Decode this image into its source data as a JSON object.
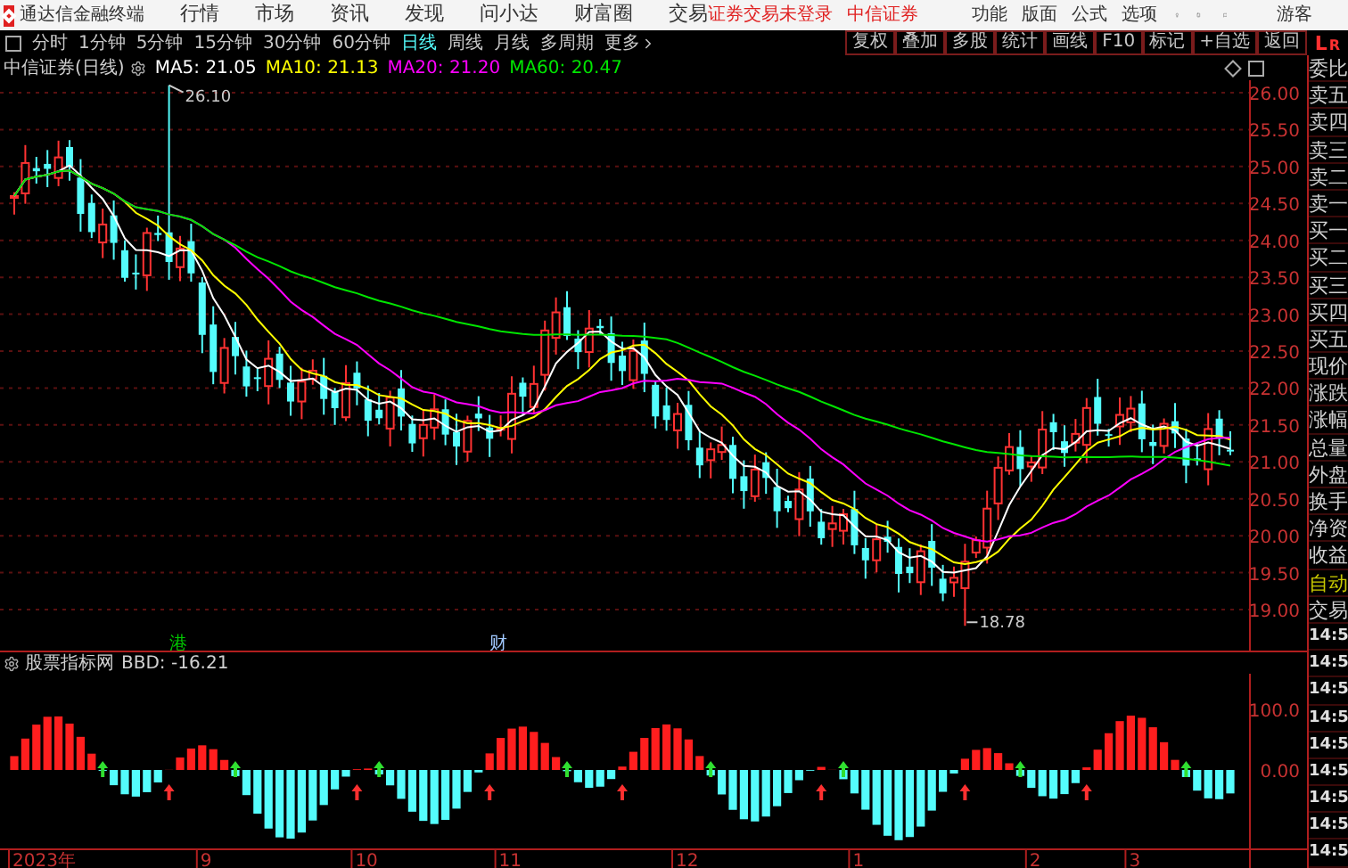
{
  "menu_bar": {
    "app_name": "通达信金融终端",
    "menus": [
      "行情",
      "市场",
      "资讯",
      "发现",
      "问小达",
      "财富圈",
      "交易"
    ],
    "login_status": "证券交易未登录",
    "broker": "中信证券",
    "actions": [
      "功能",
      "版面",
      "公式",
      "选项"
    ],
    "user": "游客"
  },
  "toolbar": {
    "periods": [
      {
        "label": "分时",
        "selected": false
      },
      {
        "label": "1分钟",
        "selected": false
      },
      {
        "label": "5分钟",
        "selected": false
      },
      {
        "label": "15分钟",
        "selected": false
      },
      {
        "label": "30分钟",
        "selected": false
      },
      {
        "label": "60分钟",
        "selected": false
      },
      {
        "label": "日线",
        "selected": true
      },
      {
        "label": "周线",
        "selected": false
      },
      {
        "label": "月线",
        "selected": false
      },
      {
        "label": "多周期",
        "selected": false
      },
      {
        "label": "更多",
        "selected": false
      }
    ],
    "buttons": [
      "复权",
      "叠加",
      "多股",
      "统计",
      "画线",
      "F10",
      "标记",
      "+自选",
      "返回"
    ],
    "panel_toggle": [
      "L",
      "R"
    ]
  },
  "legend": {
    "title": "中信证券(日线)",
    "averages": [
      {
        "label": "MA5: 21.05",
        "color": "#ffffff"
      },
      {
        "label": "MA10: 21.13",
        "color": "#ffff00"
      },
      {
        "label": "MA20: 21.20",
        "color": "#ff00ff"
      },
      {
        "label": "MA60: 20.47",
        "color": "#00e600"
      }
    ]
  },
  "price_axis": [
    "26.00",
    "25.50",
    "25.00",
    "24.50",
    "24.00",
    "23.50",
    "23.00",
    "22.50",
    "22.00",
    "21.50",
    "21.00",
    "20.50",
    "20.00",
    "19.50",
    "19.00"
  ],
  "high_label": "26.10",
  "low_label": "18.78",
  "event_marks": [
    {
      "label": "港",
      "color": "#00c800"
    },
    {
      "label": "财",
      "color": "#a0c8ff"
    }
  ],
  "indicator": {
    "label": "股票指标网",
    "reading": "BBD: -16.21",
    "axis": [
      "100.0",
      "0.00"
    ]
  },
  "dates": [
    "2023年",
    "9",
    "10",
    "11",
    "12",
    "1",
    "2",
    "3"
  ],
  "side_panel": [
    {
      "label": "委比",
      "kind": "label"
    },
    {
      "label": "卖五",
      "kind": "label"
    },
    {
      "label": "卖四",
      "kind": "label"
    },
    {
      "label": "卖三",
      "kind": "label"
    },
    {
      "label": "卖二",
      "kind": "label"
    },
    {
      "label": "卖一",
      "kind": "label"
    },
    {
      "label": "买一",
      "kind": "label"
    },
    {
      "label": "买二",
      "kind": "label"
    },
    {
      "label": "买三",
      "kind": "label"
    },
    {
      "label": "买四",
      "kind": "label"
    },
    {
      "label": "买五",
      "kind": "label"
    },
    {
      "label": "现价",
      "kind": "label"
    },
    {
      "label": "涨跌",
      "kind": "label"
    },
    {
      "label": "涨幅",
      "kind": "label"
    },
    {
      "label": "总量",
      "kind": "label"
    },
    {
      "label": "外盘",
      "kind": "label"
    },
    {
      "label": "换手",
      "kind": "label"
    },
    {
      "label": "净资",
      "kind": "label"
    },
    {
      "label": "收益",
      "kind": "label"
    },
    {
      "label": "自动",
      "kind": "toggle"
    },
    {
      "label": "交易",
      "kind": "label"
    },
    {
      "label": "14:5",
      "kind": "time"
    },
    {
      "label": "14:5",
      "kind": "time"
    },
    {
      "label": "14:5",
      "kind": "time"
    },
    {
      "label": "14:5",
      "kind": "time"
    },
    {
      "label": "14:5",
      "kind": "time"
    },
    {
      "label": "14:5",
      "kind": "time"
    },
    {
      "label": "14:5",
      "kind": "time"
    },
    {
      "label": "14:5",
      "kind": "time"
    },
    {
      "label": "14:5",
      "kind": "time"
    }
  ]
}
